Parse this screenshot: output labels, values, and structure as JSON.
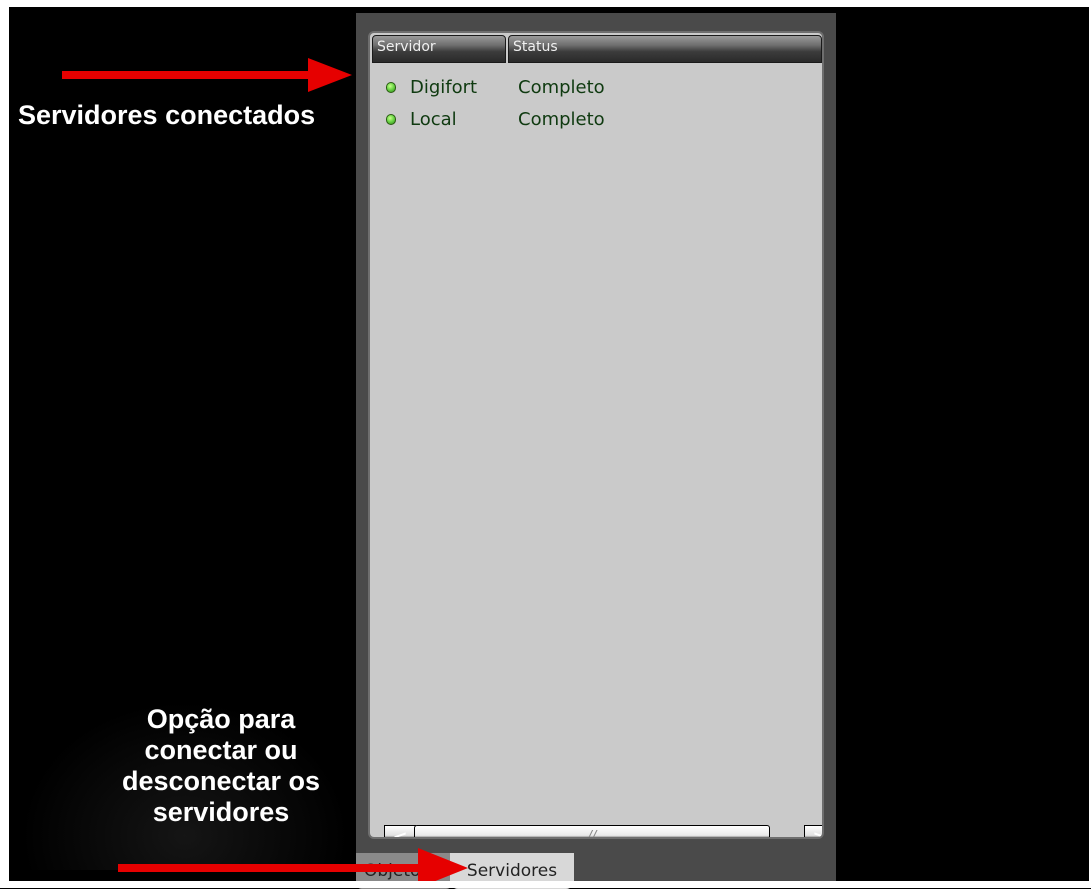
{
  "list": {
    "columns": [
      "Servidor",
      "Status"
    ],
    "rows": [
      {
        "name": "Digifort",
        "status": "Completo",
        "indicator": "green-status-icon"
      },
      {
        "name": "Local",
        "status": "Completo",
        "indicator": "green-status-icon"
      }
    ]
  },
  "scrollbar": {
    "left_symbol": "<",
    "right_symbol": ">",
    "thumb_grip": "//"
  },
  "tabs": [
    {
      "label": "Objetos",
      "active": false
    },
    {
      "label": "Servidores",
      "active": true
    }
  ],
  "annotations": {
    "connected": "Servidores conectados",
    "option_lines": [
      "Opção para",
      "conectar ou",
      "desconectar os",
      "servidores"
    ]
  },
  "colors": {
    "background": "#000000",
    "panel": "#cacaca",
    "status_green": "#6fd84a",
    "arrow_red": "#e60000",
    "row_text": "#0f3a10"
  }
}
